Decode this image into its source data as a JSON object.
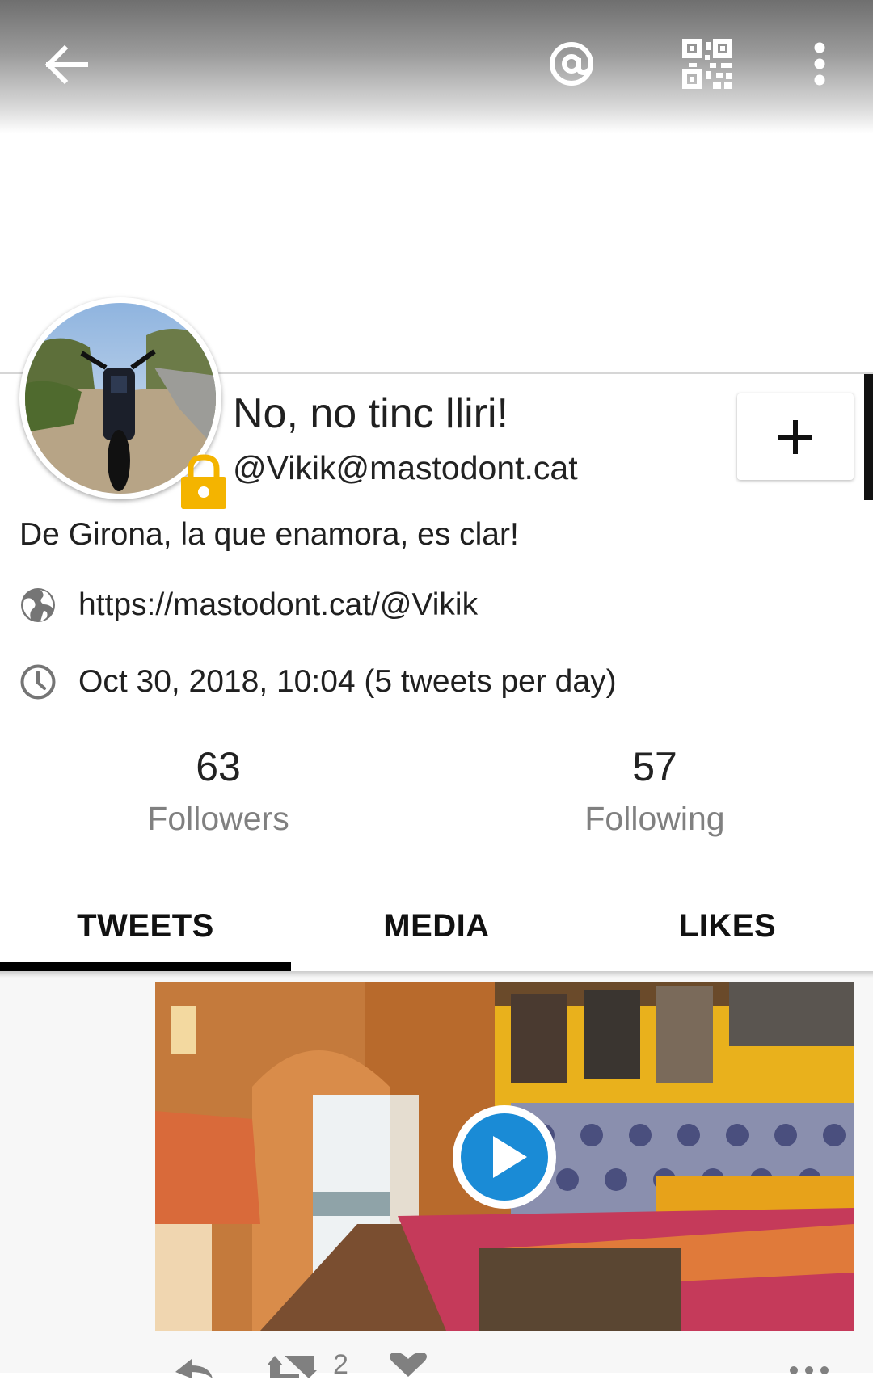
{
  "toolbar": {
    "back_icon": "arrow-back-icon",
    "mention_icon": "at-sign-icon",
    "qr_icon": "qr-code-icon",
    "more_icon": "more-vertical-icon"
  },
  "profile": {
    "display_name": "No, no tinc lliri!",
    "handle": "@Vikik@mastodont.cat",
    "bio": "De Girona, la que enamora, es clar!",
    "url": "https://mastodont.cat/@Vikik",
    "joined": "Oct 30, 2018, 10:04 (5 tweets per day)",
    "locked": true,
    "follow_icon": "plus-icon"
  },
  "stats": {
    "followers_count": "63",
    "followers_label": "Followers",
    "following_count": "57",
    "following_label": "Following"
  },
  "tabs": [
    {
      "label": "TWEETS",
      "selected": true
    },
    {
      "label": "MEDIA",
      "selected": false
    },
    {
      "label": "LIKES",
      "selected": false
    }
  ],
  "tweet": {
    "media_type": "video",
    "retweet_count": "2"
  },
  "colors": {
    "accent": "#1a8bd6",
    "lock": "#f4b400",
    "muted_text": "#808080"
  }
}
